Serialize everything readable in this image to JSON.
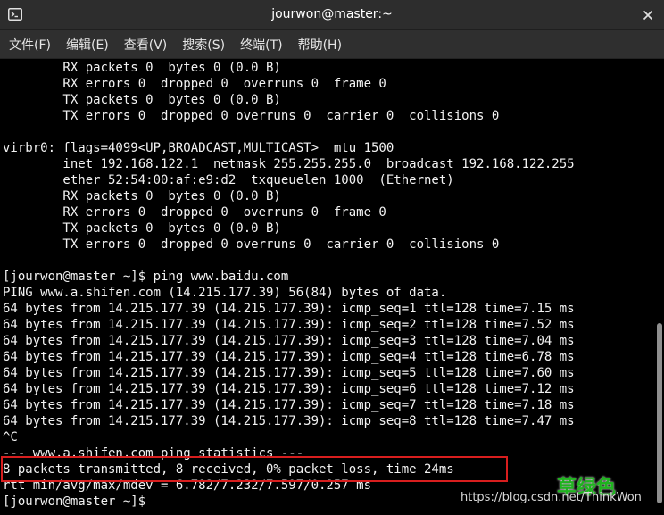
{
  "window": {
    "title": "jourwon@master:~"
  },
  "menu": [
    {
      "label": "文件(F)"
    },
    {
      "label": "编辑(E)"
    },
    {
      "label": "查看(V)"
    },
    {
      "label": "搜索(S)"
    },
    {
      "label": "终端(T)"
    },
    {
      "label": "帮助(H)"
    }
  ],
  "terminal": {
    "lines": [
      "        RX packets 0  bytes 0 (0.0 B)",
      "        RX errors 0  dropped 0  overruns 0  frame 0",
      "        TX packets 0  bytes 0 (0.0 B)",
      "        TX errors 0  dropped 0 overruns 0  carrier 0  collisions 0",
      "",
      "virbr0: flags=4099<UP,BROADCAST,MULTICAST>  mtu 1500",
      "        inet 192.168.122.1  netmask 255.255.255.0  broadcast 192.168.122.255",
      "        ether 52:54:00:af:e9:d2  txqueuelen 1000  (Ethernet)",
      "        RX packets 0  bytes 0 (0.0 B)",
      "        RX errors 0  dropped 0  overruns 0  frame 0",
      "        TX packets 0  bytes 0 (0.0 B)",
      "        TX errors 0  dropped 0 overruns 0  carrier 0  collisions 0",
      "",
      "[jourwon@master ~]$ ping www.baidu.com",
      "PING www.a.shifen.com (14.215.177.39) 56(84) bytes of data.",
      "64 bytes from 14.215.177.39 (14.215.177.39): icmp_seq=1 ttl=128 time=7.15 ms",
      "64 bytes from 14.215.177.39 (14.215.177.39): icmp_seq=2 ttl=128 time=7.52 ms",
      "64 bytes from 14.215.177.39 (14.215.177.39): icmp_seq=3 ttl=128 time=7.04 ms",
      "64 bytes from 14.215.177.39 (14.215.177.39): icmp_seq=4 ttl=128 time=6.78 ms",
      "64 bytes from 14.215.177.39 (14.215.177.39): icmp_seq=5 ttl=128 time=7.60 ms",
      "64 bytes from 14.215.177.39 (14.215.177.39): icmp_seq=6 ttl=128 time=7.12 ms",
      "64 bytes from 14.215.177.39 (14.215.177.39): icmp_seq=7 ttl=128 time=7.18 ms",
      "64 bytes from 14.215.177.39 (14.215.177.39): icmp_seq=8 ttl=128 time=7.47 ms",
      "^C",
      "--- www.a.shifen.com ping statistics ---",
      "8 packets transmitted, 8 received, 0% packet loss, time 24ms",
      "rtt min/avg/max/mdev = 6.782/7.232/7.597/0.257 ms",
      "[jourwon@master ~]$ "
    ]
  },
  "watermark": {
    "brand": "草绿色",
    "url": "https://blog.csdn.net/ThinkWon"
  },
  "colors": {
    "highlight_border": "#d81e1e",
    "watermark_green": "#1fb31f"
  }
}
